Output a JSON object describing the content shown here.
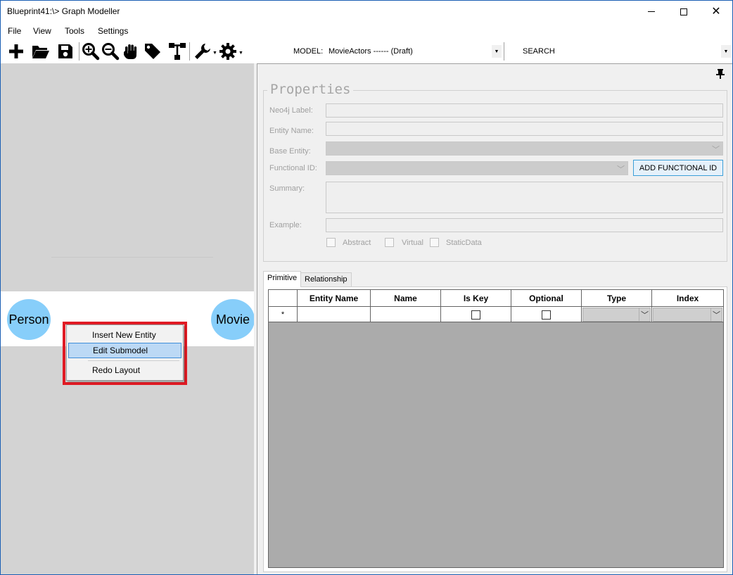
{
  "window": {
    "title": "Blueprint41:\\> Graph Modeller",
    "minimize_glyph": "",
    "maximize_glyph": "",
    "close_glyph": "✕"
  },
  "menu": {
    "items": [
      "File",
      "View",
      "Tools",
      "Settings"
    ]
  },
  "toolbar": {
    "icons": [
      "add-icon",
      "open-folder-icon",
      "save-icon",
      "zoom-in-icon",
      "zoom-out-icon",
      "hand-icon",
      "tag-icon",
      "hierarchy-icon",
      "wrench-icon",
      "gear-icon"
    ],
    "model_label": "MODEL:",
    "model_value": "MovieActors ------ (Draft)",
    "search_label": "SEARCH"
  },
  "canvas": {
    "nodes": [
      "Person",
      "Movie"
    ],
    "context_menu": {
      "items": [
        "Insert New Entity",
        "Edit Submodel",
        "Redo Layout"
      ],
      "highlight_color": "#e01b24"
    }
  },
  "properties": {
    "title": "Properties",
    "labels": {
      "neo4j_label": "Neo4j Label:",
      "entity_name": "Entity Name:",
      "base_entity": "Base Entity:",
      "functional_id": "Functional ID:",
      "summary": "Summary:",
      "example": "Example:"
    },
    "add_functional_id_label": "ADD FUNCTIONAL ID",
    "checkboxes": [
      "Abstract",
      "Virtual",
      "StaticData"
    ]
  },
  "tabs": [
    "Primitive",
    "Relationship"
  ],
  "grid": {
    "columns": [
      "",
      "Entity Name",
      "Name",
      "Is Key",
      "Optional",
      "Type",
      "Index"
    ],
    "new_row_marker": "*"
  },
  "colors": {
    "node_fill": "#87cefa",
    "canvas_bg": "#d3d3d3",
    "grid_bg": "#ababab"
  }
}
